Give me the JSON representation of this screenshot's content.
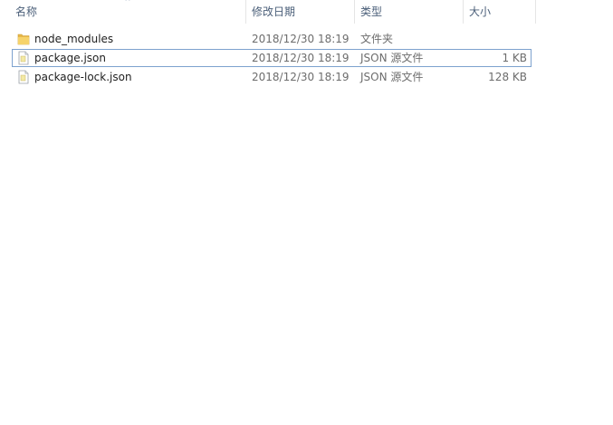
{
  "columns": {
    "name": "名称",
    "date": "修改日期",
    "type": "类型",
    "size": "大小"
  },
  "sort_indicator": "^",
  "files": [
    {
      "name": "node_modules",
      "date": "2018/12/30 18:19",
      "type": "文件夹",
      "size": "",
      "icon": "folder-icon",
      "focused": false
    },
    {
      "name": "package.json",
      "date": "2018/12/30 18:19",
      "type": "JSON 源文件",
      "size": "1 KB",
      "icon": "json-file-icon",
      "focused": true
    },
    {
      "name": "package-lock.json",
      "date": "2018/12/30 18:19",
      "type": "JSON 源文件",
      "size": "128 KB",
      "icon": "json-file-icon",
      "focused": false
    }
  ],
  "colors": {
    "header_text": "#4c607a",
    "focus_border": "#7da2ce",
    "folder_yellow": "#e8b84a"
  }
}
